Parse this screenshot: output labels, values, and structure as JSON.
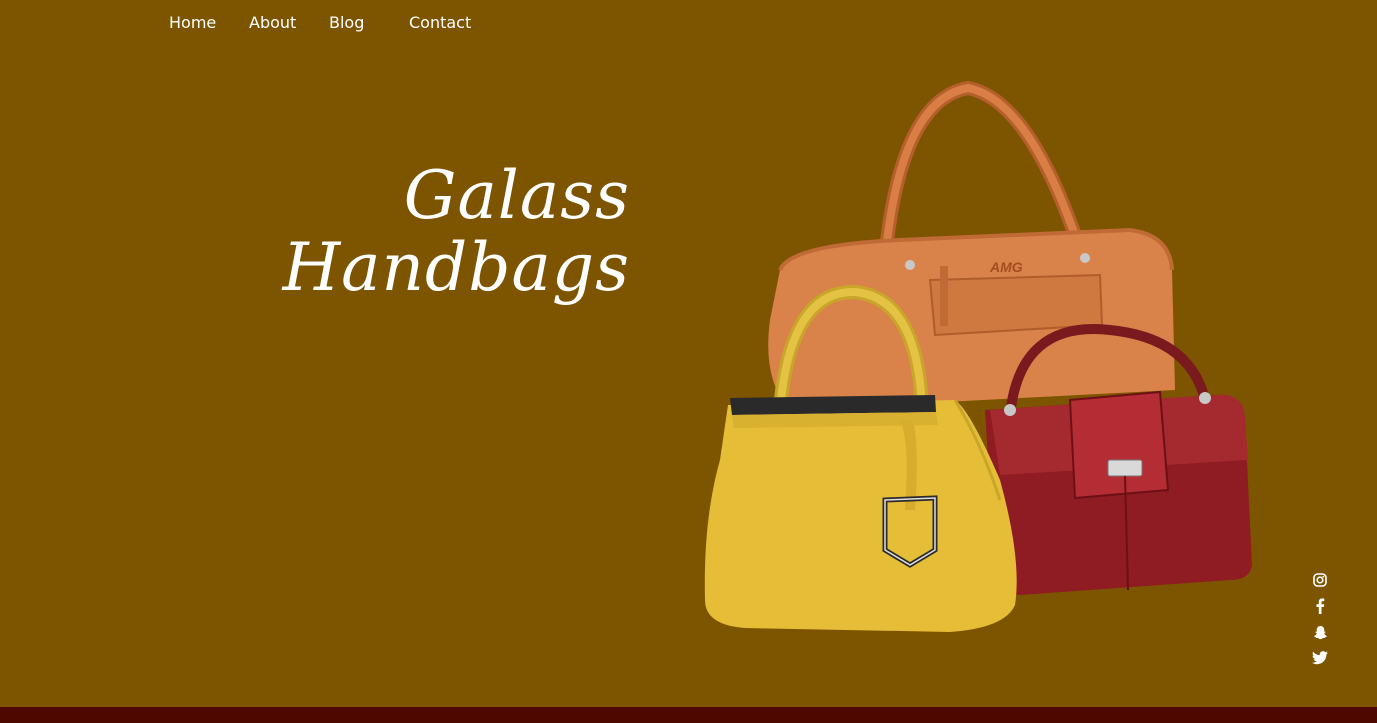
{
  "nav": {
    "items": [
      {
        "label": "Home"
      },
      {
        "label": "About"
      },
      {
        "label": "Blog"
      },
      {
        "label": "Contact"
      }
    ]
  },
  "hero": {
    "line1": "Galass",
    "line2": "Handbags",
    "bag_logo_text": "AMG"
  },
  "social": {
    "icons": [
      "instagram-icon",
      "facebook-icon",
      "snapchat-icon",
      "twitter-icon"
    ]
  },
  "colors": {
    "background": "#7d5500",
    "footer": "#4f0800",
    "text": "#ffffff"
  }
}
